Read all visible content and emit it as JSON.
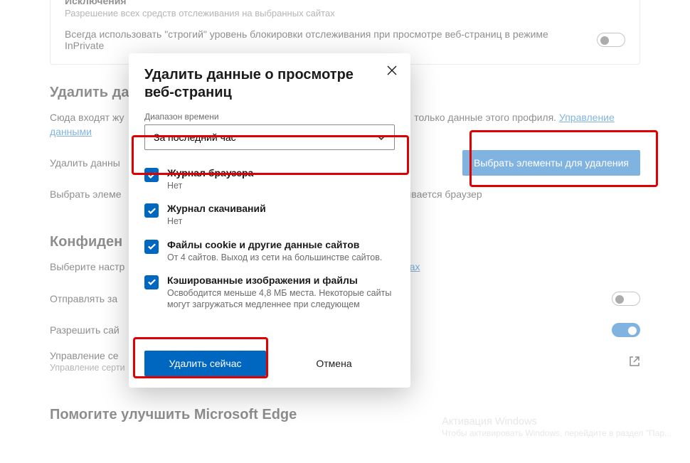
{
  "background": {
    "exceptions_card": {
      "title": "Исключения",
      "desc": "Разрешение всех средств отслеживания на выбранных сайтах",
      "strict_row": "Всегда использовать \"строгий\" уровень блокировки отслеживания при просмотре веб-страниц в режиме InPrivate"
    },
    "clear_section": {
      "title_partial": "Удалить да",
      "intro_left": "Сюда входят жу",
      "intro_right": "только данные этого профиля.",
      "link_text": "Управление данными",
      "row_clear_left": "Удалить данны",
      "choose_btn": "Выбрать элементы для удаления",
      "row_choose_left": "Выбрать элеме",
      "row_choose_right": "ивается браузер"
    },
    "privacy_section": {
      "title_partial": "Конфиден",
      "intro_left": "Выберите настр",
      "intro_link_partial": "б этих настройках",
      "row_send": "Отправлять за",
      "row_allow": "Разрешить сай",
      "row_cert": "Управление се",
      "row_cert_sub": "Управление серти"
    },
    "improve_section": {
      "title": "Помогите улучшить Microsoft Edge"
    },
    "watermark": {
      "line1": "Активация Windows",
      "line2": "Чтобы активировать Windows, перейдите в раздел \"Пар..."
    }
  },
  "modal": {
    "title": "Удалить данные о просмотре веб-страниц",
    "range_label": "Диапазон времени",
    "range_value": "За последний час",
    "items": [
      {
        "label": "Журнал браузера",
        "sub": "Нет"
      },
      {
        "label": "Журнал скачиваний",
        "sub": "Нет"
      },
      {
        "label": "Файлы cookie и другие данные сайтов",
        "sub": "От 4 сайтов. Выход из сети на большинстве сайтов."
      },
      {
        "label": "Кэшированные изображения и файлы",
        "sub": "Освободится меньше 4,8 МБ места. Некоторые сайты могут загружаться медленнее при следующем"
      }
    ],
    "clear_btn": "Удалить сейчас",
    "cancel_btn": "Отмена"
  }
}
